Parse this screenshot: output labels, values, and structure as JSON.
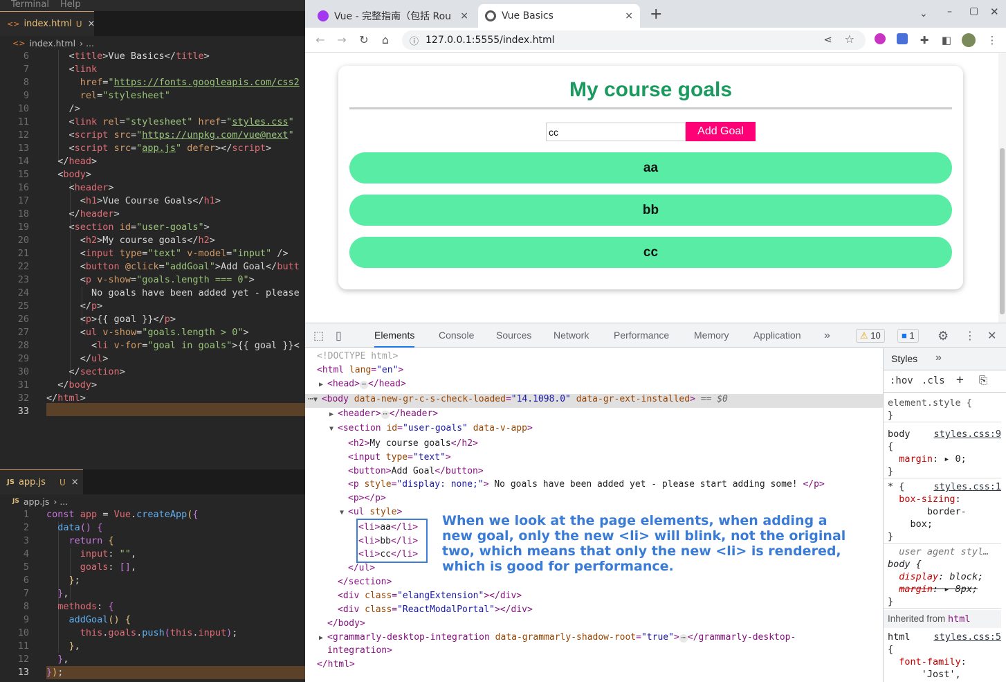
{
  "vscode": {
    "menu": [
      "Terminal",
      "Help"
    ],
    "top_tab": {
      "label": "index.html",
      "status": "U",
      "close": "×"
    },
    "top_breadcrumb": {
      "file": "index.html",
      "rest": "› ..."
    },
    "bottom_tab": {
      "label": "app.js",
      "status": "U",
      "close": "×"
    },
    "bottom_breadcrumb": {
      "file": "app.js",
      "rest": "› ..."
    },
    "html_line_numbers": [
      "6",
      "7",
      "8",
      "9",
      "10",
      "11",
      "12",
      "13",
      "14",
      "15",
      "16",
      "17",
      "18",
      "19",
      "20",
      "21",
      "22",
      "23",
      "24",
      "25",
      "26",
      "27",
      "28",
      "29",
      "30",
      "31",
      "32",
      "33"
    ],
    "js_line_numbers": [
      "1",
      "2",
      "3",
      "4",
      "5",
      "6",
      "7",
      "8",
      "9",
      "10",
      "11",
      "12",
      "13"
    ]
  },
  "browser": {
    "tabs": [
      {
        "title": "Vue - 完整指南（包括 Rou",
        "close": "×"
      },
      {
        "title": "Vue Basics",
        "close": "×"
      }
    ],
    "new_tab": "+",
    "url": "127.0.0.1:5555/index.html",
    "page": {
      "heading": "My course goals",
      "input_value": "cc",
      "add_button": "Add Goal",
      "goals": [
        "aa",
        "bb",
        "cc"
      ]
    }
  },
  "devtools": {
    "tabs": [
      "Elements",
      "Console",
      "Sources",
      "Network",
      "Performance",
      "Memory",
      "Application"
    ],
    "more": "»",
    "warnings": "10",
    "messages": "1",
    "styles_tab": "Styles",
    "styles_more": "»",
    "filter_hov": ":hov",
    "filter_cls": ".cls",
    "annotation": "When we look at the page elements, when adding a new goal, only the new <li> will blink, not the original two, which means that only the new <li> is rendered, which is good for performance."
  },
  "colors": {
    "goal_bg": "#58eca4",
    "heading": "#1a9a5f",
    "button": "#ff0077",
    "annotation": "#3a7bd5"
  }
}
